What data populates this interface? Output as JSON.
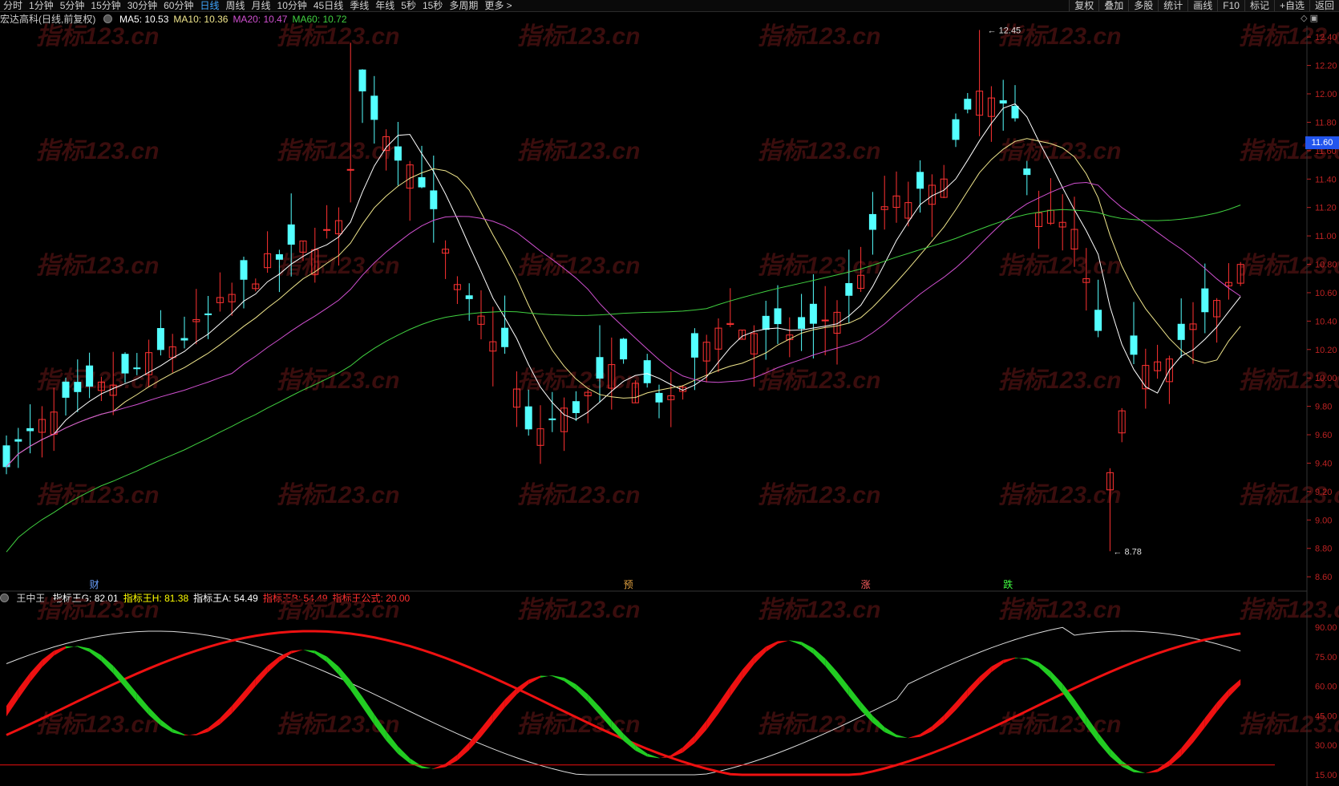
{
  "toolbar": {
    "periods": [
      "分时",
      "1分钟",
      "5分钟",
      "15分钟",
      "30分钟",
      "60分钟",
      "日线",
      "周线",
      "月线",
      "10分钟",
      "45日线",
      "季线",
      "年线",
      "5秒",
      "15秒",
      "多周期",
      "更多 >"
    ],
    "active_period": "日线",
    "right_tools": [
      "复权",
      "叠加",
      "多股",
      "统计",
      "画线",
      "F10",
      "标记",
      "+自选",
      "返回"
    ]
  },
  "main_panel": {
    "stock": "宏达高科(日线,前复权)",
    "ma": [
      {
        "label": "MA5: 10.53",
        "color": "#ffffff"
      },
      {
        "label": "MA10: 10.36",
        "color": "#f0e68c"
      },
      {
        "label": "MA20: 10.47",
        "color": "#d050d0"
      },
      {
        "label": "MA60: 10.72",
        "color": "#40d040"
      }
    ],
    "y_axis": [
      "12.40",
      "12.20",
      "12.00",
      "11.80",
      "11.60",
      "11.40",
      "11.20",
      "11.00",
      "10.80",
      "10.60",
      "10.40",
      "10.20",
      "10.00",
      "9.80",
      "9.60",
      "9.40",
      "9.20",
      "9.00",
      "8.80",
      "8.60"
    ],
    "current_price": "11.60",
    "high_label": "12.45",
    "low_label": "8.78",
    "markers": [
      {
        "text": "财",
        "color": "#6aa0ff"
      },
      {
        "text": "预",
        "color": "#e0a040"
      },
      {
        "text": "涨",
        "color": "#ff6060"
      },
      {
        "text": "跌",
        "color": "#40ff40"
      }
    ],
    "watermark": "指标123.cn"
  },
  "indicator_panel": {
    "name": "王中王",
    "values": [
      {
        "label": "指标王G: 82.01",
        "color": "#ffffff"
      },
      {
        "label": "指标王H: 81.38",
        "color": "#ffff00"
      },
      {
        "label": "指标王A: 54.49",
        "color": "#ffffff"
      },
      {
        "label": "指标王B: 54.49",
        "color": "#ff3030"
      },
      {
        "label": "指标王公式: 20.00",
        "color": "#ff3030"
      }
    ],
    "y_axis": [
      "90.00",
      "75.00",
      "60.00",
      "45.00",
      "30.00",
      "15.00"
    ]
  },
  "colors": {
    "up": "#ff3232",
    "down": "#54ffff",
    "ma5": "#ffffff",
    "ma10": "#f0e68c",
    "ma20": "#d050d0",
    "ma60": "#40d040",
    "green": "#22cc22",
    "red": "#ee1111"
  }
}
